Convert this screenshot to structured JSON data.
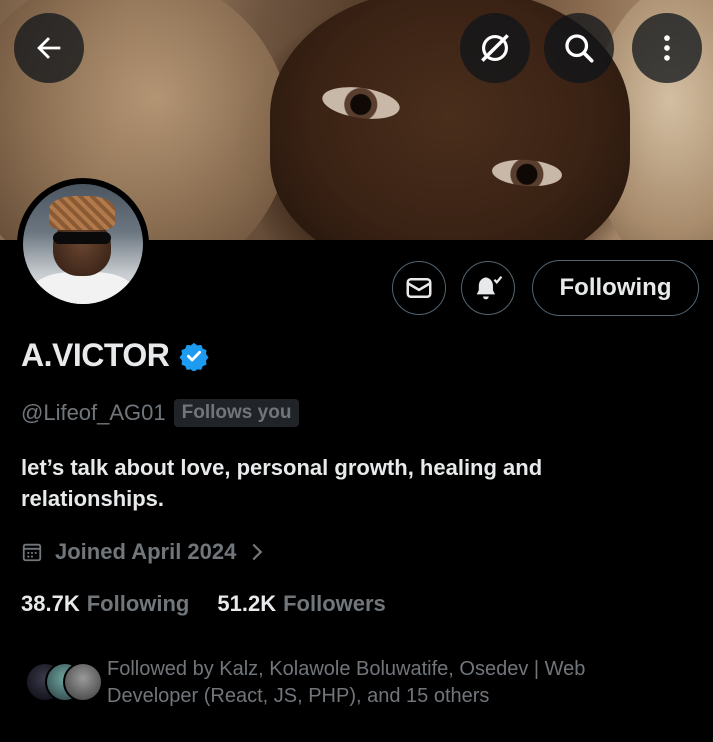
{
  "profile": {
    "display_name": "A.VICTOR",
    "handle": "@Lifeof_AG01",
    "follows_you_badge": "Follows you",
    "bio": "let’s talk about love, personal growth, healing and relationships.",
    "joined": "Joined April 2024",
    "verified": true
  },
  "stats": {
    "following_count": "38.7K",
    "following_label": "Following",
    "followers_count": "51.2K",
    "followers_label": "Followers"
  },
  "actions": {
    "following_button": "Following"
  },
  "followed_by": {
    "text": "Followed by Kalz, Kolawole Boluwatife, Osedev | Web Developer (React, JS, PHP), and 15 others"
  },
  "colors": {
    "background": "#000000",
    "text_primary": "#e7e9ea",
    "text_secondary": "#71767b",
    "verified_blue": "#1d9bf0",
    "border": "#536471"
  }
}
